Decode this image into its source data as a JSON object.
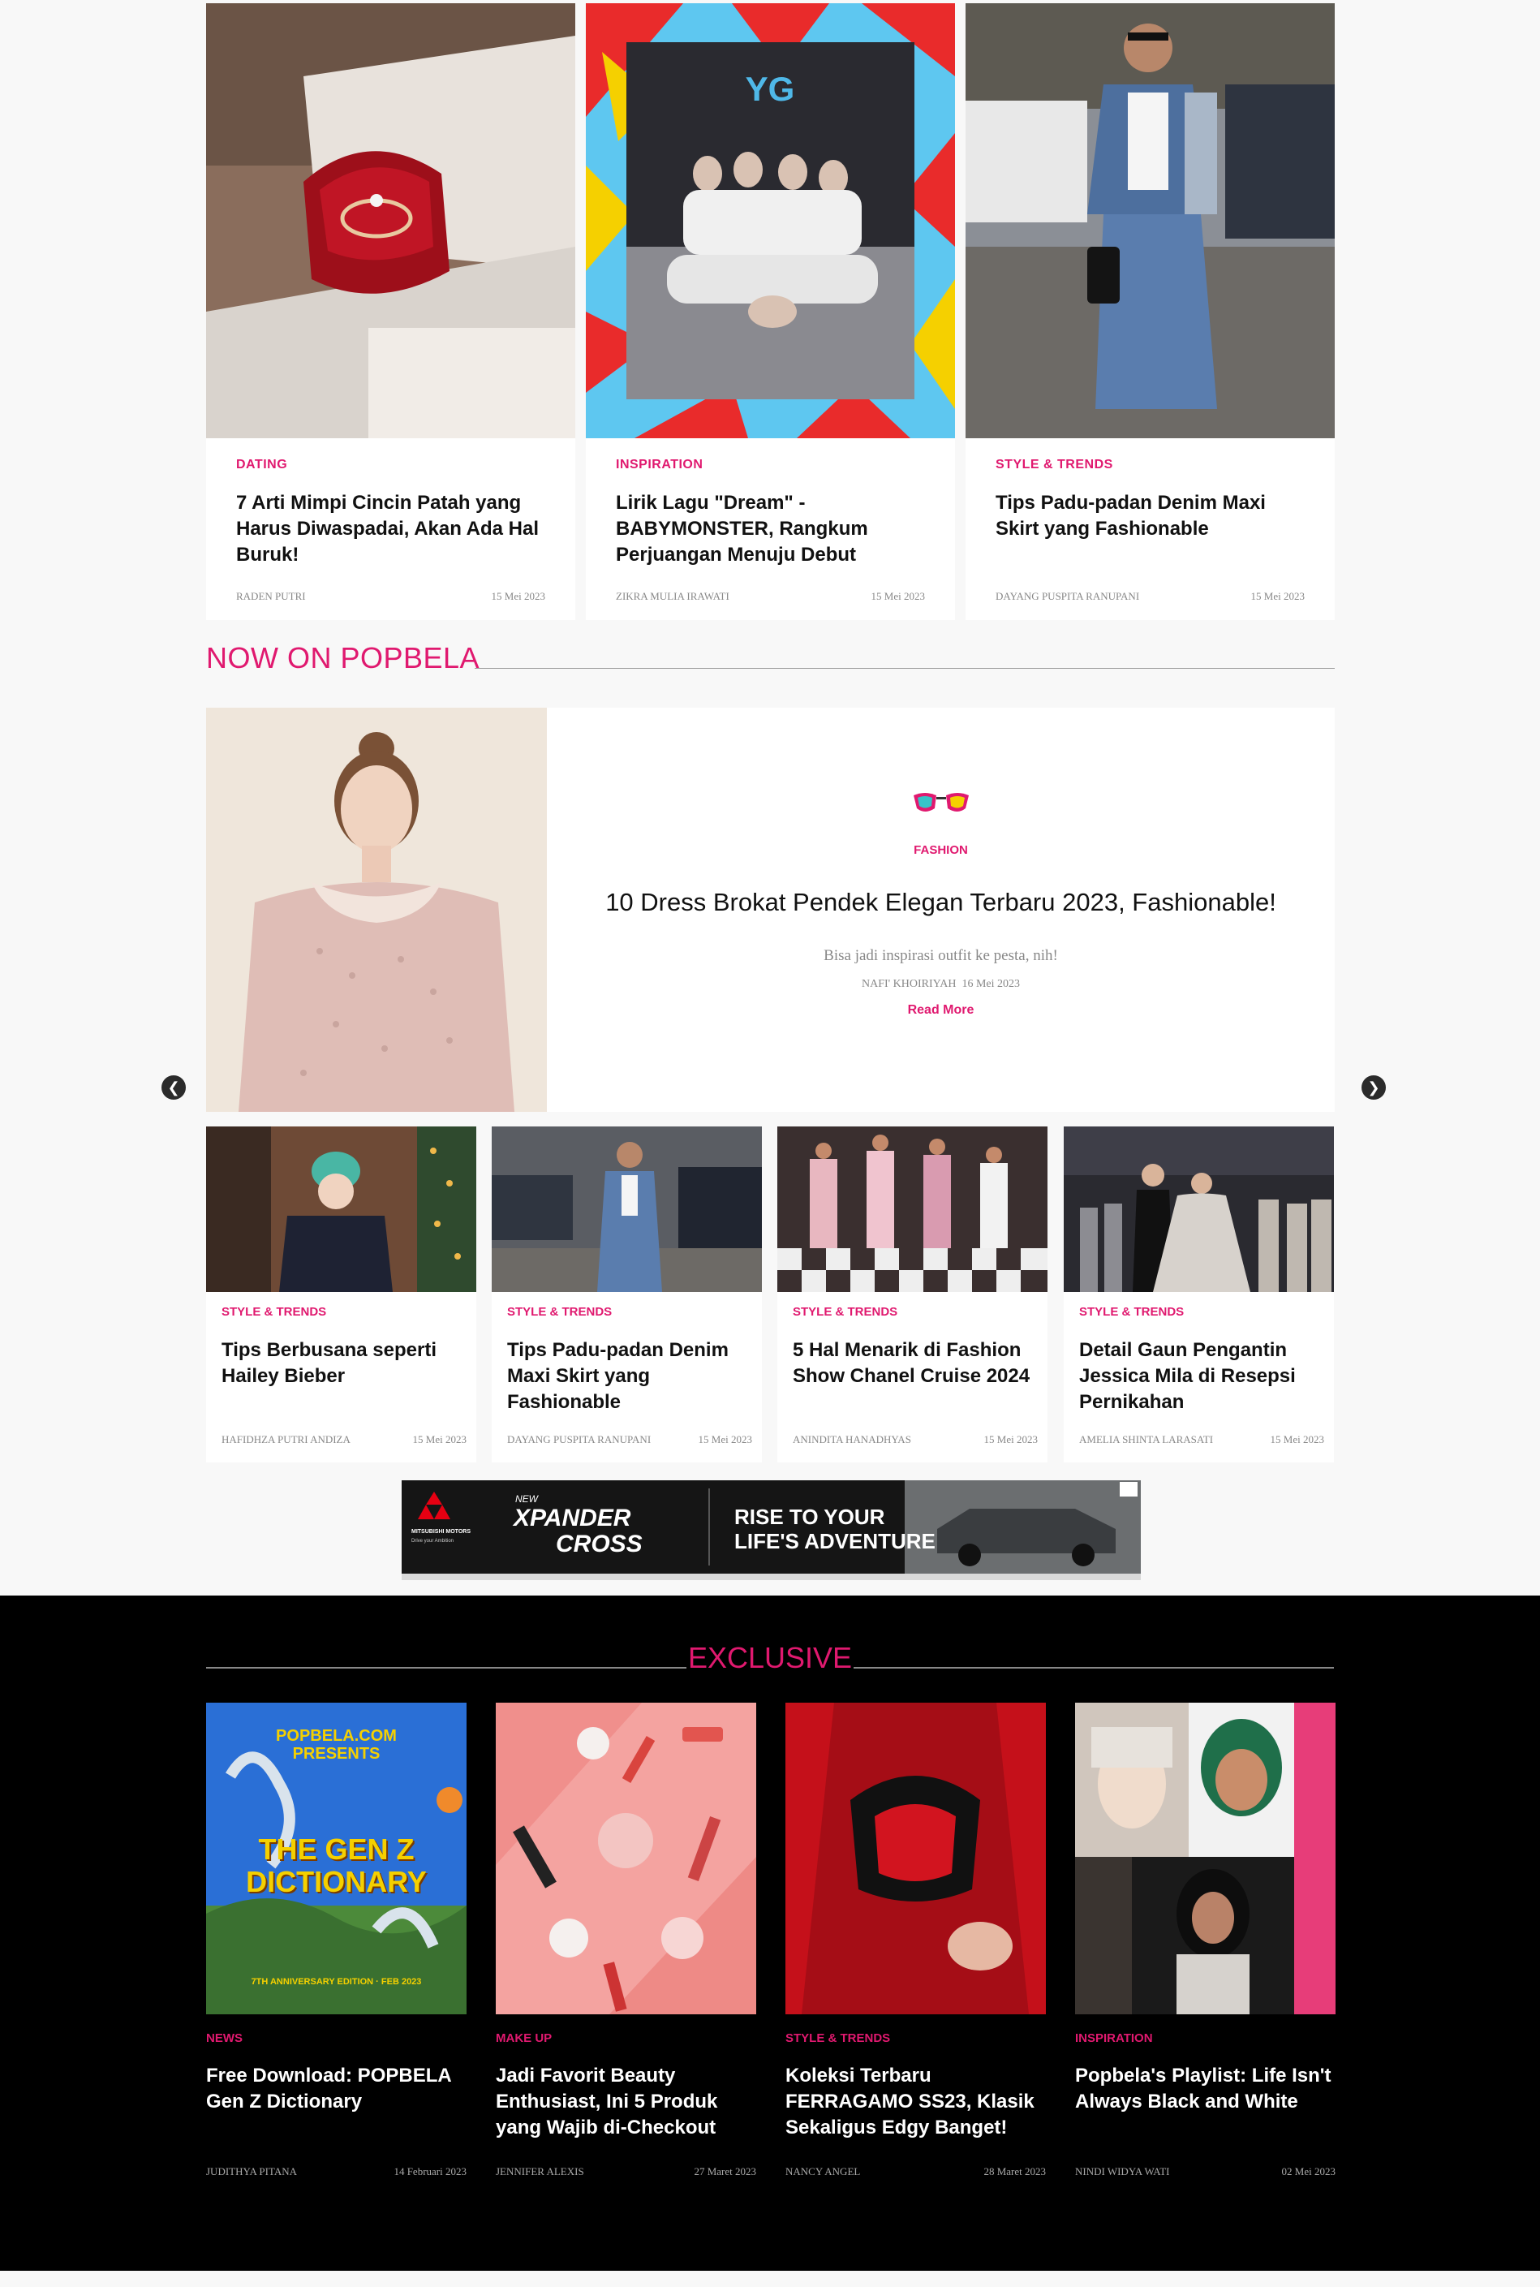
{
  "top_articles": [
    {
      "category": "DATING",
      "title": "7 Arti Mimpi Cincin Patah yang Harus Diwaspadai, Akan Ada Hal Buruk!",
      "author": "RADEN PUTRI",
      "date": "15 Mei 2023"
    },
    {
      "category": "INSPIRATION",
      "title": "Lirik Lagu \"Dream\" - BABYMONSTER, Rangkum Perjuangan Menuju Debut",
      "author": "ZIKRA MULIA IRAWATI",
      "date": "15 Mei 2023"
    },
    {
      "category": "STYLE & TRENDS",
      "title": "Tips Padu-padan Denim Maxi Skirt yang Fashionable",
      "author": "DAYANG PUSPITA RANUPANI",
      "date": "15 Mei 2023"
    }
  ],
  "now_on": {
    "heading": "NOW ON POPBELA",
    "featured": {
      "category": "FASHION",
      "title": "10 Dress Brokat Pendek Elegan Terbaru 2023, Fashionable!",
      "subtitle": "Bisa jadi inspirasi outfit ke pesta, nih!",
      "author": "NAFI' KHOIRIYAH",
      "date": "16 Mei 2023",
      "read_more": "Read More"
    },
    "prev_icon": "❮",
    "next_icon": "❯",
    "cards": [
      {
        "category": "STYLE & TRENDS",
        "title": "Tips Berbusana seperti Hailey Bieber",
        "author": "HAFIDHZA PUTRI ANDIZA",
        "date": "15 Mei 2023"
      },
      {
        "category": "STYLE & TRENDS",
        "title": "Tips Padu-padan Denim Maxi Skirt yang Fashionable",
        "author": "DAYANG PUSPITA RANUPANI",
        "date": "15 Mei 2023"
      },
      {
        "category": "STYLE & TRENDS",
        "title": "5 Hal Menarik di Fashion Show Chanel Cruise 2024",
        "author": "ANINDITA HANADHYAS",
        "date": "15 Mei 2023"
      },
      {
        "category": "STYLE & TRENDS",
        "title": "Detail Gaun Pengantin Jessica Mila di Resepsi Pernikahan",
        "author": "AMELIA SHINTA LARASATI",
        "date": "15 Mei 2023"
      }
    ]
  },
  "ad": {
    "brand": "MITSUBISHI MOTORS",
    "brand_tagline": "Drive your Ambition",
    "product_new": "NEW",
    "product_line1": "XPANDER",
    "product_line2": "CROSS",
    "headline_1": "RISE TO YOUR",
    "headline_2": "LIFE'S ADVENTURE"
  },
  "exclusive": {
    "heading": "EXCLUSIVE",
    "cards": [
      {
        "category": "NEWS",
        "title": "Free Download: POPBELA Gen Z Dictionary",
        "author": "JUDITHYA PITANA",
        "date": "14 Februari 2023",
        "cover_line1": "POPBELA.COM",
        "cover_line2": "PRESENTS",
        "cover_big1": "THE GEN Z",
        "cover_big2": "DICTIONARY",
        "cover_foot": "7TH ANNIVERSARY EDITION · FEB 2023"
      },
      {
        "category": "MAKE UP",
        "title": "Jadi Favorit Beauty Enthusiast, Ini 5 Produk yang Wajib di-Checkout",
        "author": "JENNIFER ALEXIS",
        "date": "27 Maret 2023"
      },
      {
        "category": "STYLE & TRENDS",
        "title": "Koleksi Terbaru FERRAGAMO SS23, Klasik Sekaligus Edgy Banget!",
        "author": "NANCY ANGEL",
        "date": "28 Maret 2023"
      },
      {
        "category": "INSPIRATION",
        "title": "Popbela's Playlist: Life Isn't Always Black and White",
        "author": "NINDI WIDYA WATI",
        "date": "02 Mei 2023"
      }
    ]
  },
  "colors": {
    "accent": "#e0196f",
    "dark": "#000000",
    "background": "#f8f8f8"
  }
}
